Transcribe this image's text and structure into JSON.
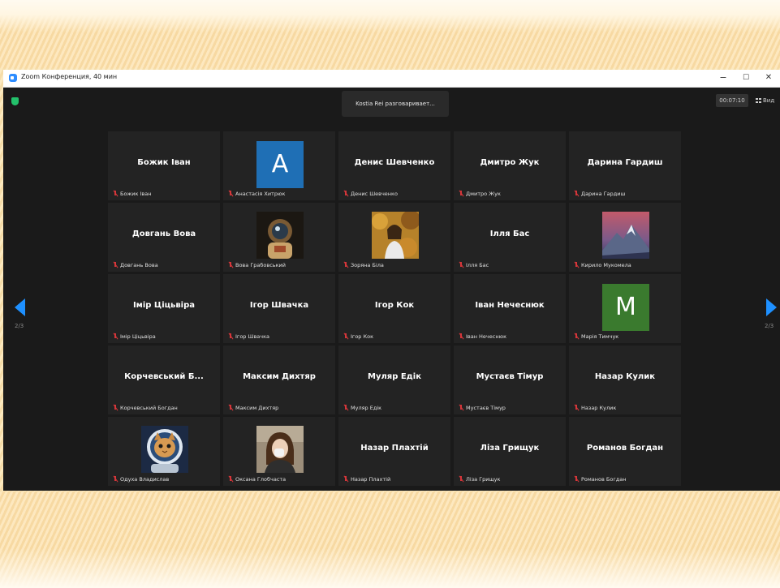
{
  "window": {
    "title": "Zoom Конференция, 40 мин",
    "controls": {
      "minimize": "−",
      "maximize": "☐",
      "close": "✕"
    }
  },
  "toolbar": {
    "talking": "Kostia Rei разговаривает...",
    "timer": "00:07:10",
    "view_label": "Вид"
  },
  "pager": {
    "left": "2/3",
    "right": "2/3"
  },
  "colors": {
    "avatar_a": "#1f6fb5",
    "avatar_m": "#3a7a2e",
    "accent": "#1e90ff",
    "mic_muted": "#d6363a"
  },
  "participants": [
    {
      "big": "Божик Іван",
      "label": "Божик Іван"
    },
    {
      "avatar_letter": "A",
      "label": "Анастасія Хитрюк"
    },
    {
      "big": "Денис Шевченко",
      "label": "Денис Шевченко"
    },
    {
      "big": "Дмитро Жук",
      "label": "Дмитро Жук"
    },
    {
      "big": "Дарина Гардиш",
      "label": "Дарина Гардиш"
    },
    {
      "big": "Довгань Вова",
      "label": "Довгань Вова"
    },
    {
      "photo": "astronaut-icon",
      "label": "Вова Грабовський"
    },
    {
      "photo": "autumn-portrait-icon",
      "label": "Зоряна Біла"
    },
    {
      "big": "Ілля Бас",
      "label": "Ілля Бас"
    },
    {
      "photo": "mountain-icon",
      "label": "Кирило Мукомела"
    },
    {
      "big": "Імір Ціцьвіра",
      "label": "Імір Ціцьвіра"
    },
    {
      "big": "Ігор Швачка",
      "label": "Ігор Швачка"
    },
    {
      "big": "Ігор Кок",
      "label": "Ігор Кок"
    },
    {
      "big": "Іван Нечеснюк",
      "label": "Іван Нечеснюк"
    },
    {
      "avatar_letter": "M",
      "label": "Марія Тимчук"
    },
    {
      "big": "Корчевський  Б...",
      "label": "Корчевський Богдан"
    },
    {
      "big": "Максим Дихтяр",
      "label": "Максим Дихтяр"
    },
    {
      "big": "Муляр Едік",
      "label": "Муляр Едік"
    },
    {
      "big": "Мустаєв Тімур",
      "label": "Мустаєв Тімур"
    },
    {
      "big": "Назар Кулик",
      "label": "Назар Кулик"
    },
    {
      "photo": "cat-astronaut-icon",
      "label": "Одуха Владислав"
    },
    {
      "photo": "girl-portrait-icon",
      "label": "Оксана Глобчаста"
    },
    {
      "big": "Назар Плахтій",
      "label": "Назар Плахтій"
    },
    {
      "big": "Ліза Грищук",
      "label": "Ліза Грищук"
    },
    {
      "big": "Романов Богдан",
      "label": "Романов Богдан"
    }
  ]
}
